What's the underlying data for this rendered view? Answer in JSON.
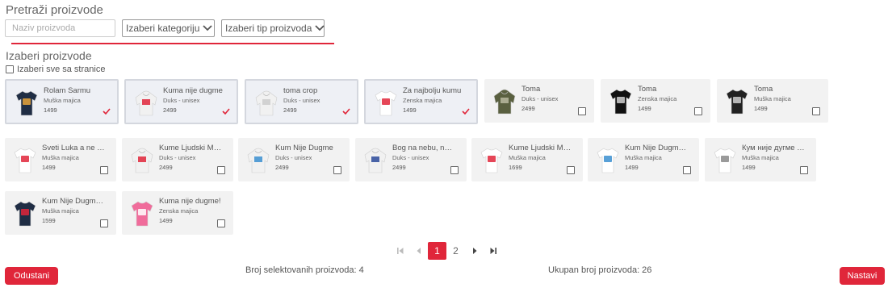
{
  "search": {
    "title": "Pretraži proizvode",
    "name_placeholder": "Naziv proizvoda",
    "category_label": "Izaberi kategoriju",
    "type_label": "Izaberi tip proizvoda"
  },
  "select": {
    "title": "Izaberi proizvode",
    "select_all_label": "Izaberi sve sa stranice"
  },
  "products": [
    {
      "name": "Rolam Sarmu",
      "type": "Muška majica",
      "price": "1499",
      "selected": true,
      "shirt_color": "#1f2d44",
      "style": "tee",
      "print": "#e8a43a"
    },
    {
      "name": "Kuma nije dugme",
      "type": "Duks - unisex",
      "price": "2499",
      "selected": true,
      "shirt_color": "#f1f1f1",
      "style": "hoodie",
      "print": "#e0263a"
    },
    {
      "name": "toma crop",
      "type": "Duks - unisex",
      "price": "2499",
      "selected": true,
      "shirt_color": "#f1f1f1",
      "style": "hoodie",
      "print": "#cccccc"
    },
    {
      "name": "Za najbolju kumu",
      "type": "Zenska majica",
      "price": "1499",
      "selected": true,
      "shirt_color": "#ffffff",
      "style": "tee",
      "print": "#e0263a"
    },
    {
      "name": "Toma",
      "type": "Duks - unisex",
      "price": "2499",
      "selected": false,
      "shirt_color": "#5a6040",
      "style": "hoodie",
      "print": "#b8b8a0"
    },
    {
      "name": "Toma",
      "type": "Zenska majica",
      "price": "1499",
      "selected": false,
      "shirt_color": "#111111",
      "style": "tee",
      "print": "#d0d0d0"
    },
    {
      "name": "Toma",
      "type": "Muška majica",
      "price": "1499",
      "selected": false,
      "shirt_color": "#222222",
      "style": "tee",
      "print": "#d0d0d0"
    },
    {
      "name": "Sveti Luka a ne noc...",
      "type": "Muška majica",
      "price": "1499",
      "selected": false,
      "shirt_color": "#ffffff",
      "style": "tee",
      "print": "#e0263a"
    },
    {
      "name": "Kume Ljudski Maks...",
      "type": "Duks - unisex",
      "price": "2499",
      "selected": false,
      "shirt_color": "#f1f1f1",
      "style": "hoodie",
      "print": "#e0263a"
    },
    {
      "name": "Kum Nije Dugme",
      "type": "Duks - unisex",
      "price": "2499",
      "selected": false,
      "shirt_color": "#f1f1f1",
      "style": "hoodie",
      "print": "#3b8fd0"
    },
    {
      "name": "Bog na nebu, na ze...",
      "type": "Duks - unisex",
      "price": "2499",
      "selected": false,
      "shirt_color": "#f1f1f1",
      "style": "hoodie",
      "print": "#2b4a9a"
    },
    {
      "name": "Kume Ljudski Maks...",
      "type": "Muška majica",
      "price": "1699",
      "selected": false,
      "shirt_color": "#ffffff",
      "style": "tee",
      "print": "#e0263a"
    },
    {
      "name": "Kum Nije Dugme L...",
      "type": "Muška majica",
      "price": "1499",
      "selected": false,
      "shirt_color": "#ffffff",
      "style": "tee",
      "print": "#3b8fd0"
    },
    {
      "name": "Кум није дугме - Ћ...",
      "type": "Muška majica",
      "price": "1499",
      "selected": false,
      "shirt_color": "#ffffff",
      "style": "tee",
      "print": "#888888"
    },
    {
      "name": "Kum Nije Dugme T...",
      "type": "Muška majica",
      "price": "1599",
      "selected": false,
      "shirt_color": "#1f2d44",
      "style": "tee",
      "print": "#e0263a"
    },
    {
      "name": "Kuma nije dugme!",
      "type": "Zenska majica",
      "price": "1499",
      "selected": false,
      "shirt_color": "#f06c9b",
      "style": "tee",
      "print": "#ffffff"
    }
  ],
  "pagination": {
    "first_icon": "first-page-icon",
    "prev_icon": "prev-page-icon",
    "pages": [
      "1",
      "2"
    ],
    "current": "1",
    "next_icon": "next-page-icon",
    "last_icon": "last-page-icon"
  },
  "footer": {
    "cancel_label": "Odustani",
    "selected_count_text": "Broj selektovanih proizvoda: 4",
    "total_count_text": "Ukupan broj proizvoda: 26",
    "next_label": "Nastavi"
  },
  "colors": {
    "accent": "#e0263a"
  }
}
